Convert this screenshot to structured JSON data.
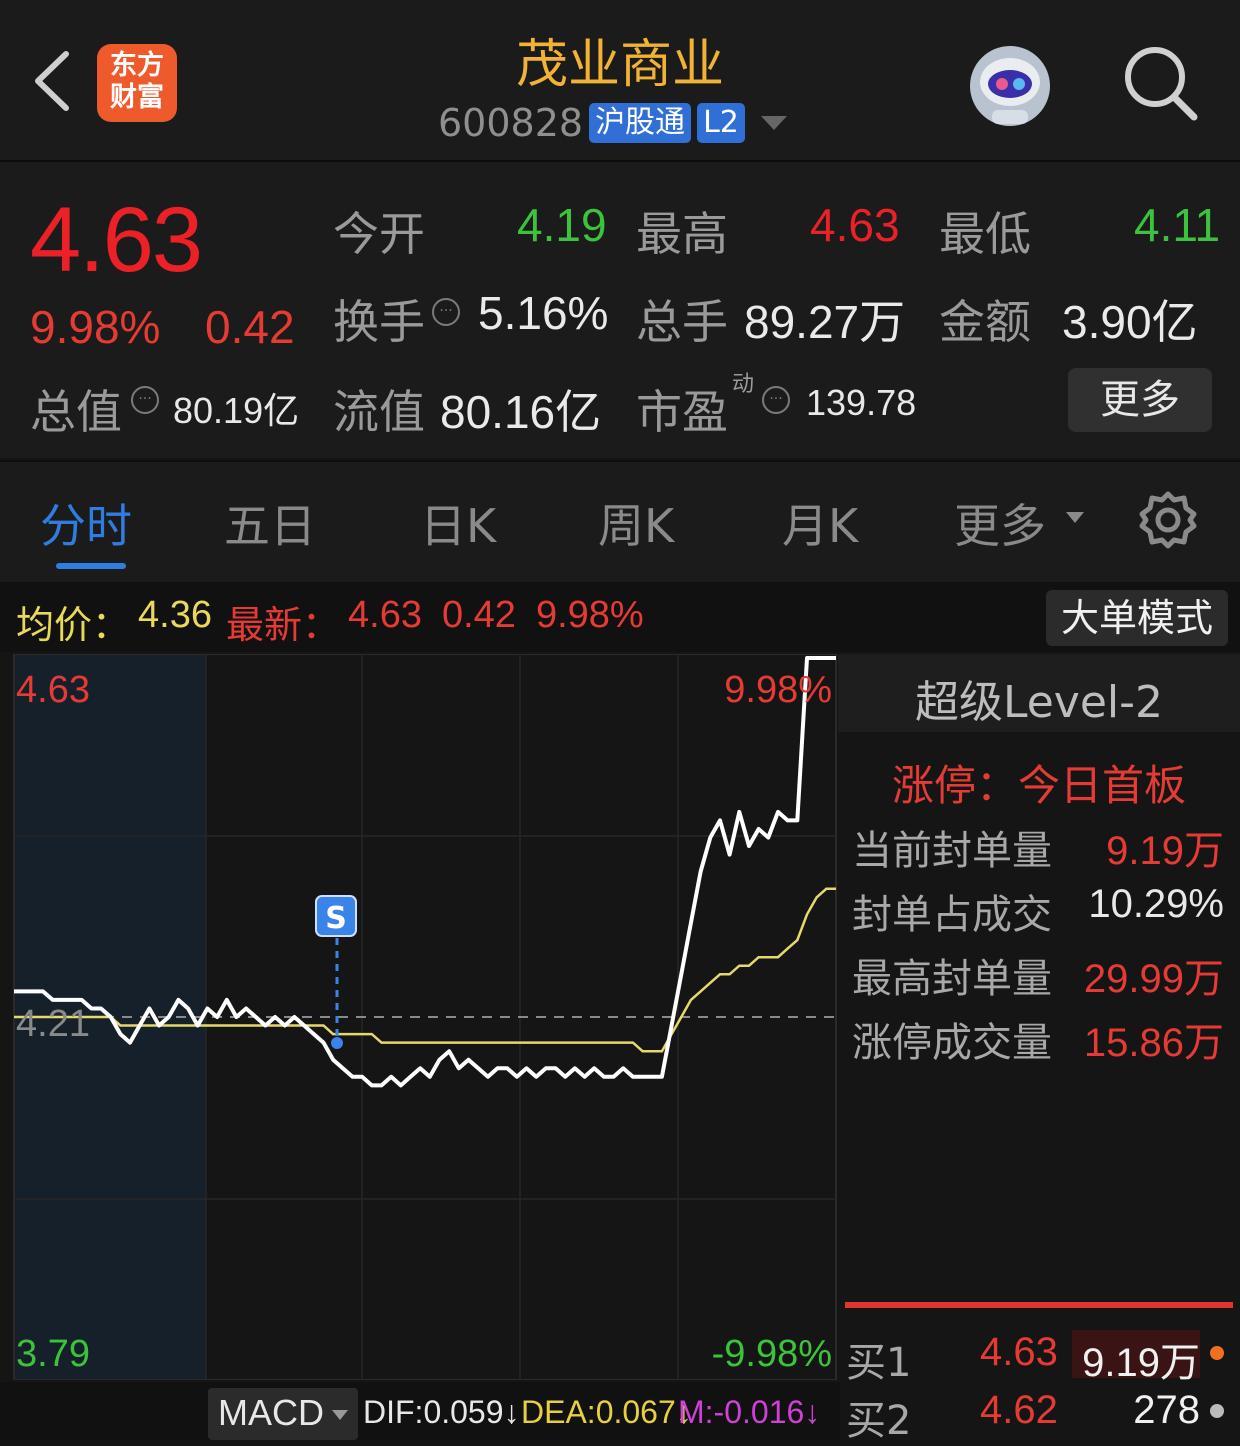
{
  "header": {
    "logo_line1": "东方",
    "logo_line2": "财富",
    "stock_name": "茂业商业",
    "stock_code": "600828",
    "tag_connect": "沪股通",
    "tag_level": "L2",
    "icons": [
      "back-arrow-icon",
      "logo-icon",
      "robot-avatar-icon",
      "search-icon"
    ]
  },
  "quote": {
    "price": "4.63",
    "change_pct": "9.98%",
    "change_amt": "0.42",
    "open_label": "今开",
    "open_value": "4.19",
    "high_label": "最高",
    "high_value": "4.63",
    "low_label": "最低",
    "low_value": "4.11",
    "turnover_label": "换手",
    "turnover_value": "5.16%",
    "volume_label": "总手",
    "volume_value": "89.27万",
    "amount_label": "金额",
    "amount_value": "3.90亿",
    "total_cap_label": "总值",
    "total_cap_value": "80.19亿",
    "float_cap_label": "流值",
    "float_cap_value": "80.16亿",
    "pe_label": "市盈",
    "pe_sup": "动",
    "pe_value": "139.78",
    "more_label": "更多",
    "colors": {
      "up": "#ec2127",
      "down": "#3bc43b"
    }
  },
  "tabs": {
    "items": [
      "分时",
      "五日",
      "日K",
      "周K",
      "月K",
      "更多"
    ],
    "active": "分时"
  },
  "avg_bar": {
    "avg_label": "均价：",
    "avg_value": "4.36",
    "latest_label": "最新：",
    "latest_price": "4.63",
    "latest_chg": "0.42",
    "latest_pct": "9.98%",
    "mode_button": "大单模式"
  },
  "chart": {
    "price_top": "4.63",
    "price_ref": "4.21",
    "price_bottom": "3.79",
    "pct_top": "9.98%",
    "pct_bottom": "-9.98%",
    "marker": "S"
  },
  "level2": {
    "title": "超级Level-2",
    "limit_label": "涨停：今日首板",
    "rows": [
      {
        "label": "当前封单量",
        "value": "9.19万"
      },
      {
        "label": "封单占成交",
        "value": "10.29%"
      },
      {
        "label": "最高封单量",
        "value": "29.99万"
      },
      {
        "label": "涨停成交量",
        "value": "15.86万"
      }
    ],
    "bids": [
      {
        "label": "买1",
        "price": "4.63",
        "qty": "9.19万"
      },
      {
        "label": "买2",
        "price": "4.62",
        "qty": "278"
      }
    ]
  },
  "macd": {
    "selector": "MACD",
    "dif": "DIF:0.059↓",
    "dea": "DEA:0.067↓",
    "m": "M:-0.016↓"
  },
  "chart_data": {
    "type": "line",
    "ylim": [
      3.79,
      4.63
    ],
    "reference": 4.21,
    "series": [
      {
        "values": [
          4.24,
          4.24,
          4.24,
          4.24,
          4.23,
          4.23,
          4.23,
          4.23,
          4.22,
          4.22,
          4.21,
          4.19,
          4.18,
          4.2,
          4.22,
          4.2,
          4.21,
          4.23,
          4.22,
          4.2,
          4.22,
          4.21,
          4.23,
          4.21,
          4.22,
          4.21,
          4.2,
          4.21,
          4.2,
          4.21,
          4.2,
          4.19,
          4.18,
          4.16,
          4.15,
          4.14,
          4.14,
          4.13,
          4.13,
          4.14,
          4.13,
          4.14,
          4.15,
          4.14,
          4.16,
          4.17,
          4.15,
          4.16,
          4.15,
          4.14,
          4.15,
          4.15,
          4.14,
          4.15,
          4.14,
          4.15,
          4.15,
          4.14,
          4.15,
          4.14,
          4.15,
          4.14,
          4.14,
          4.15,
          4.14,
          4.14,
          4.14,
          4.14,
          4.2,
          4.26,
          4.32,
          4.38,
          4.42,
          4.44,
          4.4,
          4.45,
          4.41,
          4.43,
          4.42,
          4.45,
          4.44,
          4.44,
          4.63,
          4.63,
          4.63,
          4.63
        ]
      },
      {
        "values": [
          4.21,
          4.21,
          4.21,
          4.21,
          4.21,
          4.21,
          4.21,
          4.21,
          4.21,
          4.21,
          4.21,
          4.2,
          4.2,
          4.2,
          4.2,
          4.2,
          4.2,
          4.2,
          4.2,
          4.2,
          4.2,
          4.2,
          4.2,
          4.2,
          4.2,
          4.2,
          4.2,
          4.2,
          4.2,
          4.2,
          4.2,
          4.2,
          4.2,
          4.19,
          4.19,
          4.19,
          4.19,
          4.19,
          4.18,
          4.18,
          4.18,
          4.18,
          4.18,
          4.18,
          4.18,
          4.18,
          4.18,
          4.18,
          4.18,
          4.18,
          4.18,
          4.18,
          4.18,
          4.18,
          4.18,
          4.18,
          4.18,
          4.18,
          4.18,
          4.18,
          4.18,
          4.18,
          4.18,
          4.18,
          4.18,
          4.17,
          4.17,
          4.17,
          4.19,
          4.21,
          4.23,
          4.24,
          4.25,
          4.26,
          4.26,
          4.27,
          4.27,
          4.28,
          4.28,
          4.28,
          4.29,
          4.3,
          4.33,
          4.35,
          4.36,
          4.36
        ]
      }
    ]
  }
}
